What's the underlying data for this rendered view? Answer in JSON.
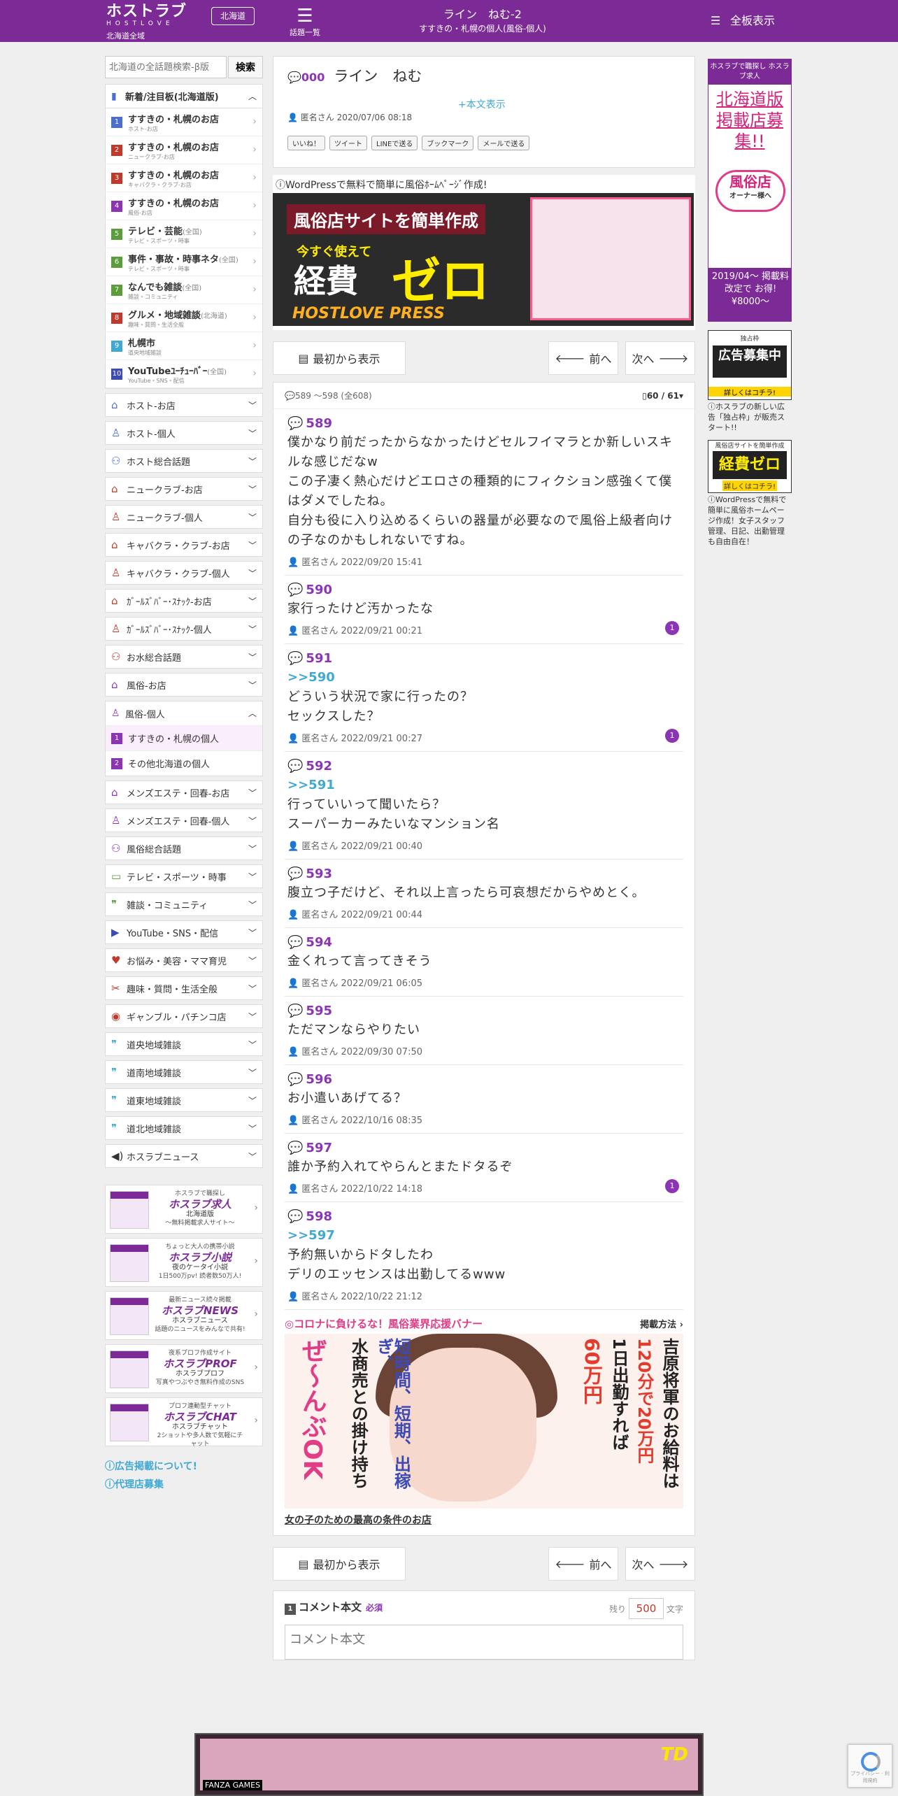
{
  "header": {
    "logo": "ホストラブ",
    "logo_sub": "HOSTLOVE",
    "area": "北海道全域",
    "region_button": "北海道",
    "topics_label": "話題一覧",
    "thread_title": "ライン　ねむ-2",
    "thread_subtitle": "すすきの・札幌の個人(風俗-個人)",
    "full_display_label": "全板表示"
  },
  "sidebar": {
    "search_placeholder": "北海道の全話題検索-β版",
    "search_button": "検索",
    "board_heading": "新着/注目板(北海道版)",
    "boards": [
      {
        "num": "1",
        "color": "#4a6fd1",
        "label": "すすきの・札幌のお店",
        "sub": "ホスト-お店"
      },
      {
        "num": "2",
        "color": "#c0392b",
        "label": "すすきの・札幌のお店",
        "sub": "ニュークラブ-お店"
      },
      {
        "num": "3",
        "color": "#c0392b",
        "label": "すすきの・札幌のお店",
        "sub": "キャバクラ・クラブ-お店"
      },
      {
        "num": "4",
        "color": "#8b35b5",
        "label": "すすきの・札幌のお店",
        "sub": "風俗-お店"
      },
      {
        "num": "5",
        "color": "#5a9e3a",
        "label": "テレビ・芸能",
        "extra": "(全国)",
        "sub": "テレビ・スポーツ・時事"
      },
      {
        "num": "6",
        "color": "#5a9e3a",
        "label": "事件・事故・時事ネタ",
        "extra": "(全国)",
        "sub": "テレビ・スポーツ・時事"
      },
      {
        "num": "7",
        "color": "#5a9e3a",
        "label": "なんでも雑談",
        "extra": "(全国)",
        "sub": "雑談・コミュニティ"
      },
      {
        "num": "8",
        "color": "#c0392b",
        "label": "グルメ・地域雑談",
        "extra": "(北海道)",
        "sub": "趣味・質問・生活全般"
      },
      {
        "num": "9",
        "color": "#3fa9d4",
        "label": "札幌市",
        "sub": "道央地域雑談"
      },
      {
        "num": "10",
        "color": "#3b4ab5",
        "label": "YouTubeﾕｰﾁｭｰﾊﾞｰ",
        "extra": "(全国)",
        "sub": "YouTube・SNS・配信"
      }
    ],
    "categories": [
      {
        "icon": "⌂",
        "color": "#4a6fd1",
        "label": "ホスト-お店"
      },
      {
        "icon": "♙",
        "color": "#4a6fd1",
        "label": "ホスト-個人"
      },
      {
        "icon": "⚇",
        "color": "#4a6fd1",
        "label": "ホスト総合話題"
      },
      {
        "icon": "⌂",
        "color": "#c0392b",
        "label": "ニュークラブ-お店"
      },
      {
        "icon": "♙",
        "color": "#c0392b",
        "label": "ニュークラブ-個人"
      },
      {
        "icon": "⌂",
        "color": "#c0392b",
        "label": "キャバクラ・クラブ-お店"
      },
      {
        "icon": "♙",
        "color": "#c0392b",
        "label": "キャバクラ・クラブ-個人"
      },
      {
        "icon": "⌂",
        "color": "#c0392b",
        "label": "ｶﾞｰﾙｽﾞﾊﾞｰ･ｽﾅｯｸ-お店"
      },
      {
        "icon": "♙",
        "color": "#c0392b",
        "label": "ｶﾞｰﾙｽﾞﾊﾞｰ･ｽﾅｯｸ-個人"
      },
      {
        "icon": "⚇",
        "color": "#c0392b",
        "label": "お水総合話題"
      },
      {
        "icon": "⌂",
        "color": "#8b35b5",
        "label": "風俗-お店"
      }
    ],
    "open_category": {
      "icon": "♙",
      "color": "#8b35b5",
      "label": "風俗-個人",
      "items": [
        {
          "num": "1",
          "label": "すすきの・札幌の個人"
        },
        {
          "num": "2",
          "label": "その他北海道の個人"
        }
      ]
    },
    "categories2": [
      {
        "icon": "⌂",
        "color": "#8b35b5",
        "label": "メンズエステ・回春-お店"
      },
      {
        "icon": "♙",
        "color": "#8b35b5",
        "label": "メンズエステ・回春-個人"
      },
      {
        "icon": "⚇",
        "color": "#8b35b5",
        "label": "風俗総合話題"
      },
      {
        "icon": "▭",
        "color": "#5a9e3a",
        "label": "テレビ・スポーツ・時事"
      },
      {
        "icon": "❞",
        "color": "#5a9e3a",
        "label": "雑談・コミュニティ"
      },
      {
        "icon": "▶",
        "color": "#3b4ab5",
        "label": "YouTube・SNS・配信"
      },
      {
        "icon": "♥",
        "color": "#c0392b",
        "label": "お悩み・美容・ママ育児"
      },
      {
        "icon": "✂",
        "color": "#c0392b",
        "label": "趣味・質問・生活全般"
      },
      {
        "icon": "◉",
        "color": "#c0392b",
        "label": "ギャンブル・パチンコ店"
      },
      {
        "icon": "❞",
        "color": "#3fa9d4",
        "label": "道央地域雑談"
      },
      {
        "icon": "❞",
        "color": "#3fa9d4",
        "label": "道南地域雑談"
      },
      {
        "icon": "❞",
        "color": "#3fa9d4",
        "label": "道東地域雑談"
      },
      {
        "icon": "❞",
        "color": "#3fa9d4",
        "label": "道北地域雑談"
      },
      {
        "icon": "◀)",
        "color": "#333333",
        "label": "ホスラブニュース"
      }
    ],
    "promos": [
      {
        "l1": "ホスラブで職探し",
        "l2": "ホスラブ求人",
        "l3": "北海道版",
        "l4": "〜無料掲載求人サイト〜"
      },
      {
        "l1": "ちょっと大人の携帯小説",
        "l2": "ホスラブ小説",
        "l3": "夜のケータイ小説",
        "l4": "1日500万pv! 読者数50万人!"
      },
      {
        "l1": "最新ニュース続々掲載",
        "l2": "ホスラブNEWS",
        "l3": "ホスラブニュース",
        "l4": "話題のニュースをみんなで共有!"
      },
      {
        "l1": "夜系プロフ作成サイト",
        "l2": "ホスラブPROF",
        "l3": "ホスラブプロフ",
        "l4": "写真やつぶやき無料作成のSNS"
      },
      {
        "l1": "プロフ連動型チャット",
        "l2": "ホスラブCHAT",
        "l3": "ホスラブチャット",
        "l4": "2ショットや多人数で気軽にチャット"
      }
    ],
    "links": [
      "広告掲載について!",
      "代理店募集"
    ]
  },
  "thread": {
    "num": "000",
    "title": "ライン　ねむ",
    "show_body": "+本文表示",
    "author_date": "匿名さん 2020/07/06 08:18",
    "share": [
      "いいね！",
      "ツイート",
      "LINEで送る",
      "ブックマーク",
      "メールで送る"
    ]
  },
  "wp_ad": {
    "caption": "WordPressで無料で簡単に風俗ﾎｰﾑﾍﾟｰｼﾞ作成!",
    "b1": "風俗店サイトを簡単作成",
    "b2": "今すぐ使えて",
    "b3": "経費",
    "b4": "ゼロ",
    "b5": "HOSTLOVE PRESS"
  },
  "pager": {
    "first": "最初から表示",
    "prev": "前へ",
    "next": "次へ"
  },
  "posts_header": {
    "range": "589 ～598 (全608)",
    "page": "60 / 61"
  },
  "posts": [
    {
      "num": "589",
      "reply": "",
      "lines": [
        "僕かなり前だったからなかったけどセルフイマラとか新しいスキルな感じだなw",
        "この子凄く熱心だけどエロさの種類的にフィクション感強くて僕はダメでしたね。",
        "自分も役に入り込めるくらいの器量が必要なので風俗上級者向けの子なのかもしれないですね。"
      ],
      "meta": "匿名さん 2022/09/20 15:41",
      "count": ""
    },
    {
      "num": "590",
      "reply": "",
      "lines": [
        "家行ったけど汚かったな"
      ],
      "meta": "匿名さん 2022/09/21 00:21",
      "count": "1"
    },
    {
      "num": "591",
      "reply": ">>590",
      "lines": [
        "どういう状況で家に行ったの？",
        "セックスした？"
      ],
      "meta": "匿名さん 2022/09/21 00:27",
      "count": "1"
    },
    {
      "num": "592",
      "reply": ">>591",
      "lines": [
        "行っていいって聞いたら？",
        "スーパーカーみたいなマンション名"
      ],
      "meta": "匿名さん 2022/09/21 00:40",
      "count": ""
    },
    {
      "num": "593",
      "reply": "",
      "lines": [
        "腹立つ子だけど、それ以上言ったら可哀想だからやめとく。"
      ],
      "meta": "匿名さん 2022/09/21 00:44",
      "count": ""
    },
    {
      "num": "594",
      "reply": "",
      "lines": [
        "金くれって言ってきそう"
      ],
      "meta": "匿名さん 2022/09/21 06:05",
      "count": ""
    },
    {
      "num": "595",
      "reply": "",
      "lines": [
        "ただマンならやりたい"
      ],
      "meta": "匿名さん 2022/09/30 07:50",
      "count": ""
    },
    {
      "num": "596",
      "reply": "",
      "lines": [
        "お小遣いあげてる？"
      ],
      "meta": "匿名さん 2022/10/16 08:35",
      "count": ""
    },
    {
      "num": "597",
      "reply": "",
      "lines": [
        "誰か予約入れてやらんとまたドタるぞ"
      ],
      "meta": "匿名さん 2022/10/22 14:18",
      "count": "1"
    },
    {
      "num": "598",
      "reply": ">>597",
      "lines": [
        "予約無いからドタしたわ",
        "デリのエッセンスは出勤してるwww"
      ],
      "meta": "匿名さん 2022/10/22 21:12",
      "count": ""
    }
  ],
  "ad_banner": {
    "head": "◎コロナに負けるな！風俗業界応援バナー",
    "method": "掲載方法",
    "v1": "吉原将軍のお給料は",
    "v2": "120分で20万円",
    "v3": "1日出勤すれば",
    "v4": "60万円",
    "v5": "水商売との掛け持ち",
    "v6": "短時間、短期、出稼ぎ、",
    "v7": "ぜ〜んぶOK",
    "link": "女の子のための最高の条件のお店"
  },
  "comment": {
    "num": "1",
    "label": "コメント本文",
    "required": "必須",
    "remain": "残り",
    "count": "500",
    "unit": "文字",
    "placeholder": "コメント本文"
  },
  "right_ads": {
    "a1_top": "ホスラブで職探し ホスラブ求人",
    "a1_title": "北海道版掲載店募集!!",
    "a1_badge": "風俗店",
    "a1_badge2": "オーナー様へ",
    "a1_bottom": "2019/04〜 掲載料改定で お得!¥8000〜",
    "a2_top": "独占枠",
    "a2_main": "広告募集中",
    "a2_sub": "詳しくはコチラ!",
    "a2_note": "ホスラブの新しい広告「独占枠」が販売スタート!!",
    "a3_top": "風俗店サイトを簡単作成",
    "a3_main": "経費ゼロ",
    "a3_sub": "詳しくはコチラ!",
    "a3_note": "WordPressで無料で簡単に風俗ホームページ作成！女子スタッフ管理、日記、出勤管理も自由自在！"
  },
  "footer_banner": {
    "logo": "FANZA GAMES",
    "title": "TD"
  },
  "recaptcha": {
    "label": "プライバシー - 利用規約"
  }
}
